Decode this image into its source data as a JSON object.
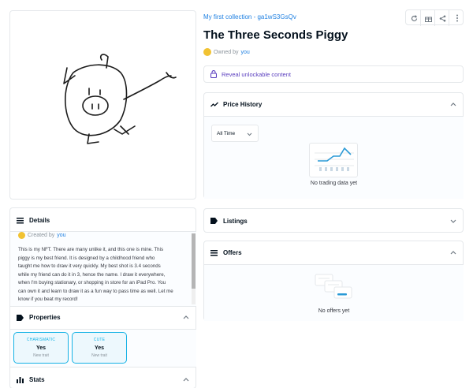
{
  "collection": {
    "name": "My first collection - ga1wS3GsQv"
  },
  "asset": {
    "title": "The Three Seconds Piggy",
    "owned_prefix": "Owned by",
    "owned_user": "you"
  },
  "toolbar": {
    "icons": [
      "refresh-icon",
      "gift-icon",
      "share-icon",
      "more-icon"
    ]
  },
  "unlockable": {
    "label": "Reveal unlockable content"
  },
  "price_history": {
    "title": "Price History",
    "range_value": "All Time",
    "empty_text": "No trading data yet"
  },
  "listings": {
    "title": "Listings"
  },
  "offers": {
    "title": "Offers",
    "empty_text": "No offers yet"
  },
  "details": {
    "title": "Details",
    "created_prefix": "Created by",
    "created_user": "you",
    "description_lines": [
      "This is my NFT. There are many unlike it, and this one is mine. This",
      "piggy is my best friend. It is designed by a childhood friend who",
      "taught me how to draw it very quickly. My best shot is 3.4 seconds",
      "while my friend can do it in 3, hence the name. I draw it everywhere,",
      "when I'm buying stationary, or shopping in store for an iPad Pro. You",
      "can own it and learn to draw it as a fun way to pass time as well. Let me",
      "know if you beat my record!"
    ]
  },
  "properties": {
    "title": "Properties",
    "traits": [
      {
        "type": "CHARISMATIC",
        "value": "Yes",
        "rarity": "New trait"
      },
      {
        "type": "CUTE",
        "value": "Yes",
        "rarity": "New trait"
      }
    ]
  },
  "stats": {
    "title": "Stats"
  },
  "colors": {
    "accent": "#2081e2",
    "trait_border": "#15b2e5",
    "border": "#e5e8eb"
  }
}
